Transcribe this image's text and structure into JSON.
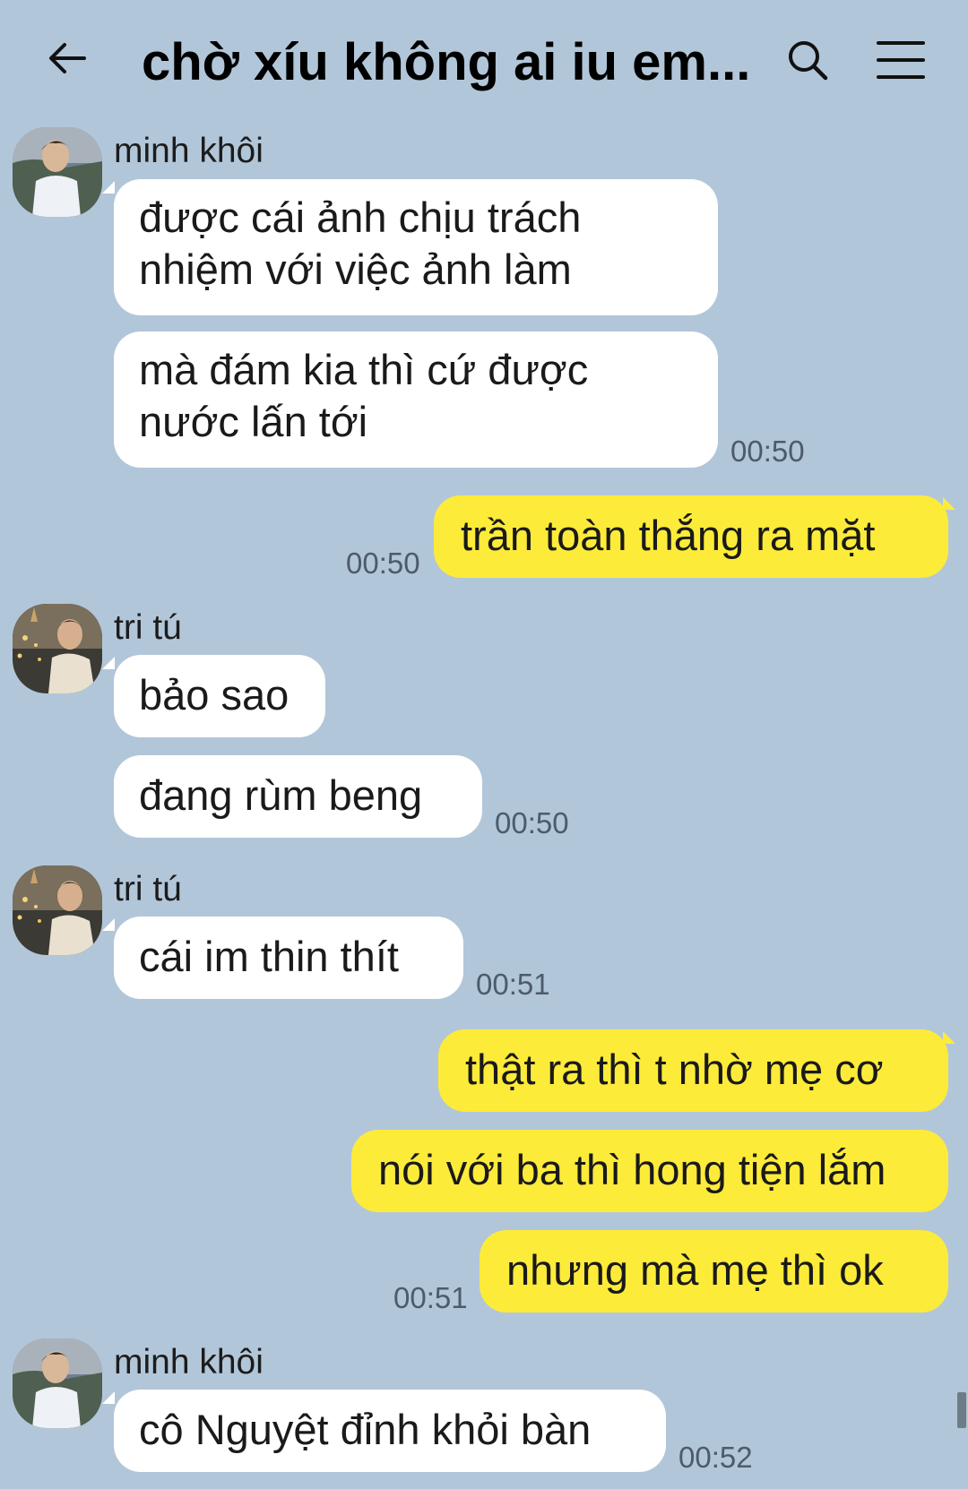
{
  "header": {
    "back_icon": "arrow-left-icon",
    "title": "chờ xíu không ai iu em...",
    "search_icon": "search-icon",
    "menu_icon": "hamburger-menu-icon"
  },
  "messages": [
    {
      "sender": "minh khôi",
      "texts": [
        "được cái ảnh chịu trách nhiệm với việc ảnh làm",
        "mà đám kia thì cứ được nước lấn tới"
      ],
      "time": "00:50"
    },
    {
      "outgoing": true,
      "texts": [
        "trần toàn thắng ra mặt"
      ],
      "time": "00:50"
    },
    {
      "sender": "tri tú",
      "texts": [
        "bảo sao",
        "đang rùm beng"
      ],
      "time": "00:50"
    },
    {
      "sender": "tri tú",
      "texts": [
        "cái im thin thít"
      ],
      "time": "00:51"
    },
    {
      "outgoing": true,
      "texts": [
        "thật ra thì t nhờ mẹ cơ",
        "nói với ba thì hong tiện lắm",
        "nhưng mà mẹ thì ok"
      ],
      "time": "00:51"
    },
    {
      "sender": "minh khôi",
      "texts": [
        "cô Nguyệt đỉnh khỏi bàn"
      ],
      "time": "00:52"
    }
  ],
  "colors": {
    "background": "#b2c6d9",
    "incoming_bubble": "#ffffff",
    "outgoing_bubble": "#fdeb3a"
  }
}
